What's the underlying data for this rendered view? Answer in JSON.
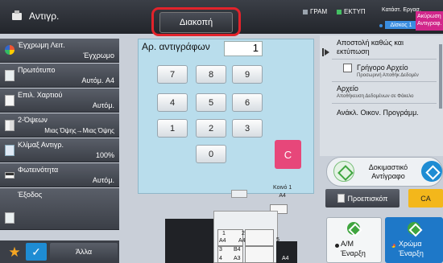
{
  "header": {
    "app_title": "Αντιγρ.",
    "stop_button": "Διακοπή",
    "indicators": [
      {
        "label": "ΓΡΑΜ",
        "color": "#9aa3ad"
      },
      {
        "label": "ΕΚΤΥΠ",
        "color": "#44c063"
      }
    ],
    "job_status": "Κατάστ. Εργασ.",
    "tray_badge": "Δίσκος 1",
    "fast_badge": "Ακύρωση Αντιγραφ."
  },
  "left_menu": [
    {
      "label": "Έγχρωμη Λειτ.",
      "value": "Έγχρωμο",
      "icon": "color-mode-icon"
    },
    {
      "label": "Πρωτότυπο",
      "value": "Αυτόμ. A4",
      "icon": "original-icon"
    },
    {
      "label": "Επιλ. Χαρτιού",
      "value": "Αυτόμ.",
      "icon": "paper-select-icon"
    },
    {
      "label": "2-Όψεων",
      "value": "Μιας Όψης→Μιας Όψης",
      "icon": "duplex-icon"
    },
    {
      "label": "Κλίμαξ Αντιγρ.",
      "value": "100%",
      "icon": "zoom-icon"
    },
    {
      "label": "Φωτεινότητα",
      "value": "Αυτόμ.",
      "icon": "exposure-icon"
    },
    {
      "label": "Έξοδος",
      "value": "",
      "icon": "output-icon"
    }
  ],
  "bottom_bar": {
    "others_label": "Άλλα",
    "star_icon": "★",
    "check_icon": "✓"
  },
  "keypad": {
    "copies_label": "Αρ. αντιγράφων",
    "copies_value": "1",
    "keys": [
      "7",
      "8",
      "9",
      "4",
      "5",
      "6",
      "1",
      "2",
      "3",
      "0"
    ],
    "clear_label": "C"
  },
  "right_panel": {
    "send_print": "Αποστολή καθώς και εκτύπωση",
    "quick_file": "Γρήγορο Αρχείο",
    "quick_file_sub": "Προσωρινή Αποθήκ Δεδομέν",
    "file": "Αρχείο",
    "file_sub": "Αποθήκευση Δεδομένων σε Φάκελο",
    "eco_recall": "Ανάκλ. Οικον. Προγράμμ.",
    "sample_copy": "Δοκιμαστικό Αντίγραφο",
    "preview": "Προεπισκόπ",
    "ca": "CA",
    "bw_start_line1": "Α/Μ",
    "bw_start_line2": "Έναρξη",
    "color_start_line1": "Χρώμα",
    "color_start_line2": "Έναρξη"
  },
  "machine": {
    "tray1_title": "Κοινό 1",
    "tray1_size": "A4",
    "trays": [
      {
        "num": "1",
        "size": "A4"
      },
      {
        "num": "2",
        "size": "A4"
      },
      {
        "num": "3",
        "size": "B4"
      },
      {
        "num": "4",
        "size": "A3"
      },
      {
        "num": "5",
        "size": "A4"
      }
    ]
  },
  "colors": {
    "accent_blue": "#1e8cd3",
    "clear_pink": "#e7477a",
    "ca_yellow": "#f3b71b",
    "highlight_red": "#e2232b",
    "keypad_bg": "#b9ddec"
  }
}
